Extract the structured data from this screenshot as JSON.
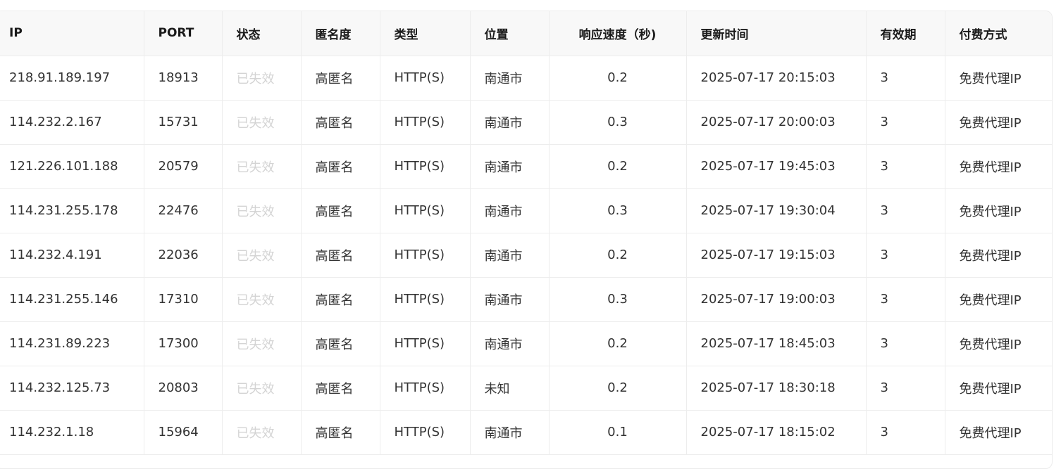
{
  "table": {
    "headers": {
      "ip": "IP",
      "port": "PORT",
      "status": "状态",
      "anonymity": "匿名度",
      "type": "类型",
      "location": "位置",
      "speed": "响应速度（秒)",
      "updated": "更新时间",
      "validity": "有效期",
      "payment": "付费方式"
    },
    "rows": [
      {
        "ip": "218.91.189.197",
        "port": "18913",
        "status": "已失效",
        "anonymity": "高匿名",
        "type": "HTTP(S)",
        "location": "南通市",
        "speed": "0.2",
        "updated": "2025-07-17 20:15:03",
        "validity": "3",
        "payment": "免费代理IP"
      },
      {
        "ip": "114.232.2.167",
        "port": "15731",
        "status": "已失效",
        "anonymity": "高匿名",
        "type": "HTTP(S)",
        "location": "南通市",
        "speed": "0.3",
        "updated": "2025-07-17 20:00:03",
        "validity": "3",
        "payment": "免费代理IP"
      },
      {
        "ip": "121.226.101.188",
        "port": "20579",
        "status": "已失效",
        "anonymity": "高匿名",
        "type": "HTTP(S)",
        "location": "南通市",
        "speed": "0.2",
        "updated": "2025-07-17 19:45:03",
        "validity": "3",
        "payment": "免费代理IP"
      },
      {
        "ip": "114.231.255.178",
        "port": "22476",
        "status": "已失效",
        "anonymity": "高匿名",
        "type": "HTTP(S)",
        "location": "南通市",
        "speed": "0.3",
        "updated": "2025-07-17 19:30:04",
        "validity": "3",
        "payment": "免费代理IP"
      },
      {
        "ip": "114.232.4.191",
        "port": "22036",
        "status": "已失效",
        "anonymity": "高匿名",
        "type": "HTTP(S)",
        "location": "南通市",
        "speed": "0.2",
        "updated": "2025-07-17 19:15:03",
        "validity": "3",
        "payment": "免费代理IP"
      },
      {
        "ip": "114.231.255.146",
        "port": "17310",
        "status": "已失效",
        "anonymity": "高匿名",
        "type": "HTTP(S)",
        "location": "南通市",
        "speed": "0.3",
        "updated": "2025-07-17 19:00:03",
        "validity": "3",
        "payment": "免费代理IP"
      },
      {
        "ip": "114.231.89.223",
        "port": "17300",
        "status": "已失效",
        "anonymity": "高匿名",
        "type": "HTTP(S)",
        "location": "南通市",
        "speed": "0.2",
        "updated": "2025-07-17 18:45:03",
        "validity": "3",
        "payment": "免费代理IP"
      },
      {
        "ip": "114.232.125.73",
        "port": "20803",
        "status": "已失效",
        "anonymity": "高匿名",
        "type": "HTTP(S)",
        "location": "未知",
        "speed": "0.2",
        "updated": "2025-07-17 18:30:18",
        "validity": "3",
        "payment": "免费代理IP"
      },
      {
        "ip": "114.232.1.18",
        "port": "15964",
        "status": "已失效",
        "anonymity": "高匿名",
        "type": "HTTP(S)",
        "location": "南通市",
        "speed": "0.1",
        "updated": "2025-07-17 18:15:02",
        "validity": "3",
        "payment": "免费代理IP"
      }
    ]
  },
  "colors": {
    "header_background": "#f8f8f8",
    "border": "#ededed",
    "text": "#333333",
    "expired_status": "#d4d4d4"
  }
}
